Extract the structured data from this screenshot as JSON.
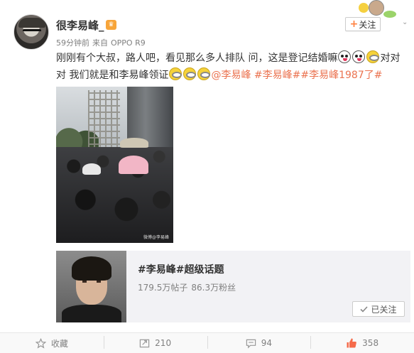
{
  "post": {
    "username": "很李易峰_",
    "time": "59分钟前",
    "source_prefix": "来自",
    "source": "OPPO R9",
    "follow_label": "关注",
    "text_part1": "刚刚有个大叔，路人吧，看见那么多人排队 问，这是登记结婚嘛",
    "text_part2": "对对对 我们就是和李易峰领证",
    "mention": "@李易峰",
    "hashtag1": "#李易峰#",
    "hashtag2": "#李易峰1987了#",
    "photo_watermark": "微博@李易峰"
  },
  "topic_card": {
    "title": "#李易峰#超级话题",
    "posts": "179.5万帖子",
    "fans": "86.3万粉丝",
    "followed_label": "已关注"
  },
  "actions": {
    "favorite_label": "收藏",
    "repost_count": "210",
    "comment_count": "94",
    "like_count": "358"
  },
  "colors": {
    "link": "#eb7350",
    "accent_orange": "#ff8140"
  }
}
